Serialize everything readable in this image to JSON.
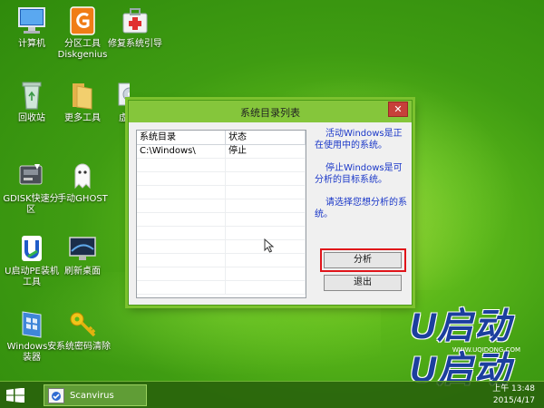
{
  "desktop": {
    "icons": [
      {
        "label": "计算机",
        "icon": "computer-icon"
      },
      {
        "label": "分区工具\nDiskgenius",
        "icon": "diskgenius-icon"
      },
      {
        "label": "修复系统引导",
        "icon": "repair-boot-icon"
      },
      {
        "label": "回收站",
        "icon": "recycle-bin-icon"
      },
      {
        "label": "更多工具",
        "icon": "folder-icon"
      },
      {
        "label": "虚",
        "icon": "disc-icon"
      },
      {
        "label": "GDISK快速分\n区",
        "icon": "gdisk-icon"
      },
      {
        "label": "手动GHOST",
        "icon": "ghost-icon"
      },
      {
        "label": "U启动PE装机\n工具",
        "icon": "uqidong-installer-icon"
      },
      {
        "label": "刷新桌面",
        "icon": "refresh-desktop-icon"
      },
      {
        "label": "Windows安\n装器",
        "icon": "windows-installer-icon"
      },
      {
        "label": "系统密码清除",
        "icon": "key-icon"
      }
    ]
  },
  "dialog": {
    "title": "系统目录列表",
    "close_label": "✕",
    "columns": [
      "系统目录",
      "状态"
    ],
    "rows": [
      {
        "dir": "C:\\Windows\\",
        "status": "停止"
      }
    ],
    "info": [
      "活动Windows是正在使用中的系统。",
      "停止Windows是可分析的目标系统。",
      "请选择您想分析的系统。"
    ],
    "analyze_label": "分析",
    "exit_label": "退出"
  },
  "watermark": {
    "brand_mark": "U启动",
    "url": "WWW.UQIDONG.COM"
  },
  "taskbar": {
    "task_label": "Scanvirus",
    "time": "上午 13:48",
    "date": "2015/4/17"
  },
  "colors": {
    "desktop_green": "#4fae16",
    "titlebar_green": "#85c63b",
    "info_text_blue": "#1a37c8",
    "highlight_red": "#e0141a",
    "close_red": "#c7403a"
  }
}
